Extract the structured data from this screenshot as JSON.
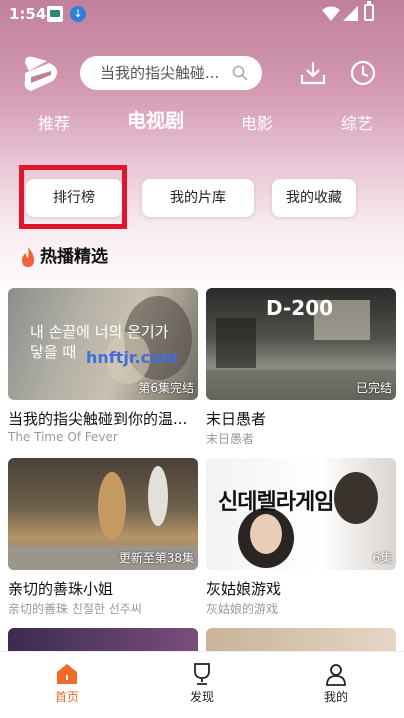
{
  "status_bar": {
    "time": "1:54"
  },
  "search": {
    "placeholder": "当我的指尖触碰..."
  },
  "tabs": [
    {
      "label": "推荐"
    },
    {
      "label": "电视剧"
    },
    {
      "label": "电影"
    },
    {
      "label": "综艺"
    }
  ],
  "sub_buttons": [
    {
      "label": "排行榜"
    },
    {
      "label": "我的片库"
    },
    {
      "label": "我的收藏"
    }
  ],
  "section": {
    "title": "热播精选"
  },
  "cards": [
    {
      "title": "当我的指尖触碰到你的温...",
      "subtitle": "The Time Of Fever",
      "badge": "第6集完结",
      "overlay_text": "내 손끝에 너의 온기가 닿을 때",
      "watermark": "hnftjr.com"
    },
    {
      "title": "末日愚者",
      "subtitle": "末日愚者",
      "badge": "已完结",
      "overlay_text": "D-200"
    },
    {
      "title": "亲切的善珠小姐",
      "subtitle": "亲切的善珠 친절한 선주씨",
      "badge": "更新至第38集"
    },
    {
      "title": "灰姑娘游戏",
      "subtitle": "灰姑娘的游戏",
      "badge": "6集",
      "overlay_text": "신데렐라게임"
    }
  ],
  "bottom_nav": [
    {
      "label": "首页"
    },
    {
      "label": "发现"
    },
    {
      "label": "我的"
    }
  ],
  "colors": {
    "accent": "#f06a2a",
    "highlight": "#e1162a",
    "header": "#c0809b"
  }
}
